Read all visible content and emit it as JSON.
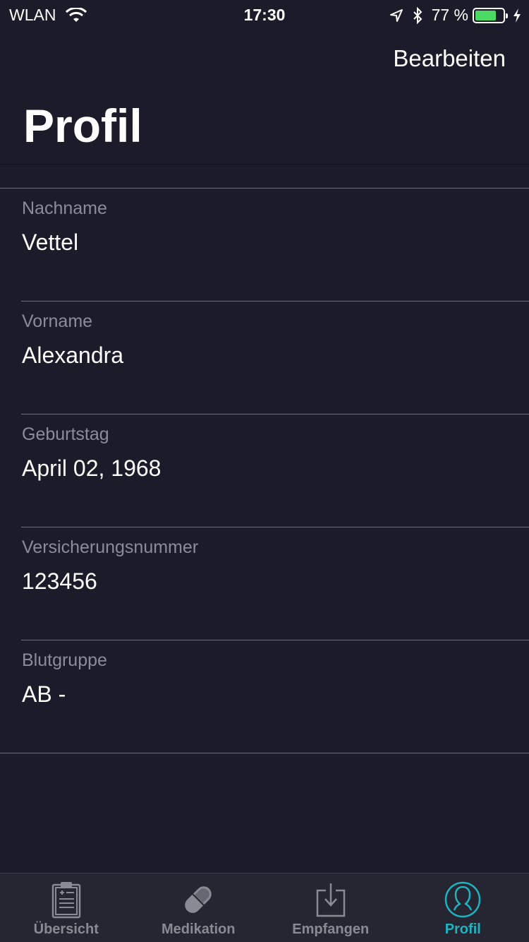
{
  "status_bar": {
    "carrier": "WLAN",
    "time": "17:30",
    "battery_percent": "77 %",
    "battery_level": 0.77
  },
  "nav": {
    "edit_label": "Bearbeiten",
    "title": "Profil"
  },
  "fields": [
    {
      "label": "Nachname",
      "value": "Vettel"
    },
    {
      "label": "Vorname",
      "value": "Alexandra"
    },
    {
      "label": "Geburtstag",
      "value": "April 02, 1968"
    },
    {
      "label": "Versicherungsnummer",
      "value": "123456"
    },
    {
      "label": "Blutgruppe",
      "value": "AB -"
    }
  ],
  "tabs": [
    {
      "label": "Übersicht",
      "icon": "clipboard-icon"
    },
    {
      "label": "Medikation",
      "icon": "pill-icon"
    },
    {
      "label": "Empfangen",
      "icon": "download-tray-icon"
    },
    {
      "label": "Profil",
      "icon": "person-icon",
      "active": true
    }
  ],
  "colors": {
    "background": "#1b1b2a",
    "accent": "#1fb2c0",
    "battery": "#4cd964"
  }
}
